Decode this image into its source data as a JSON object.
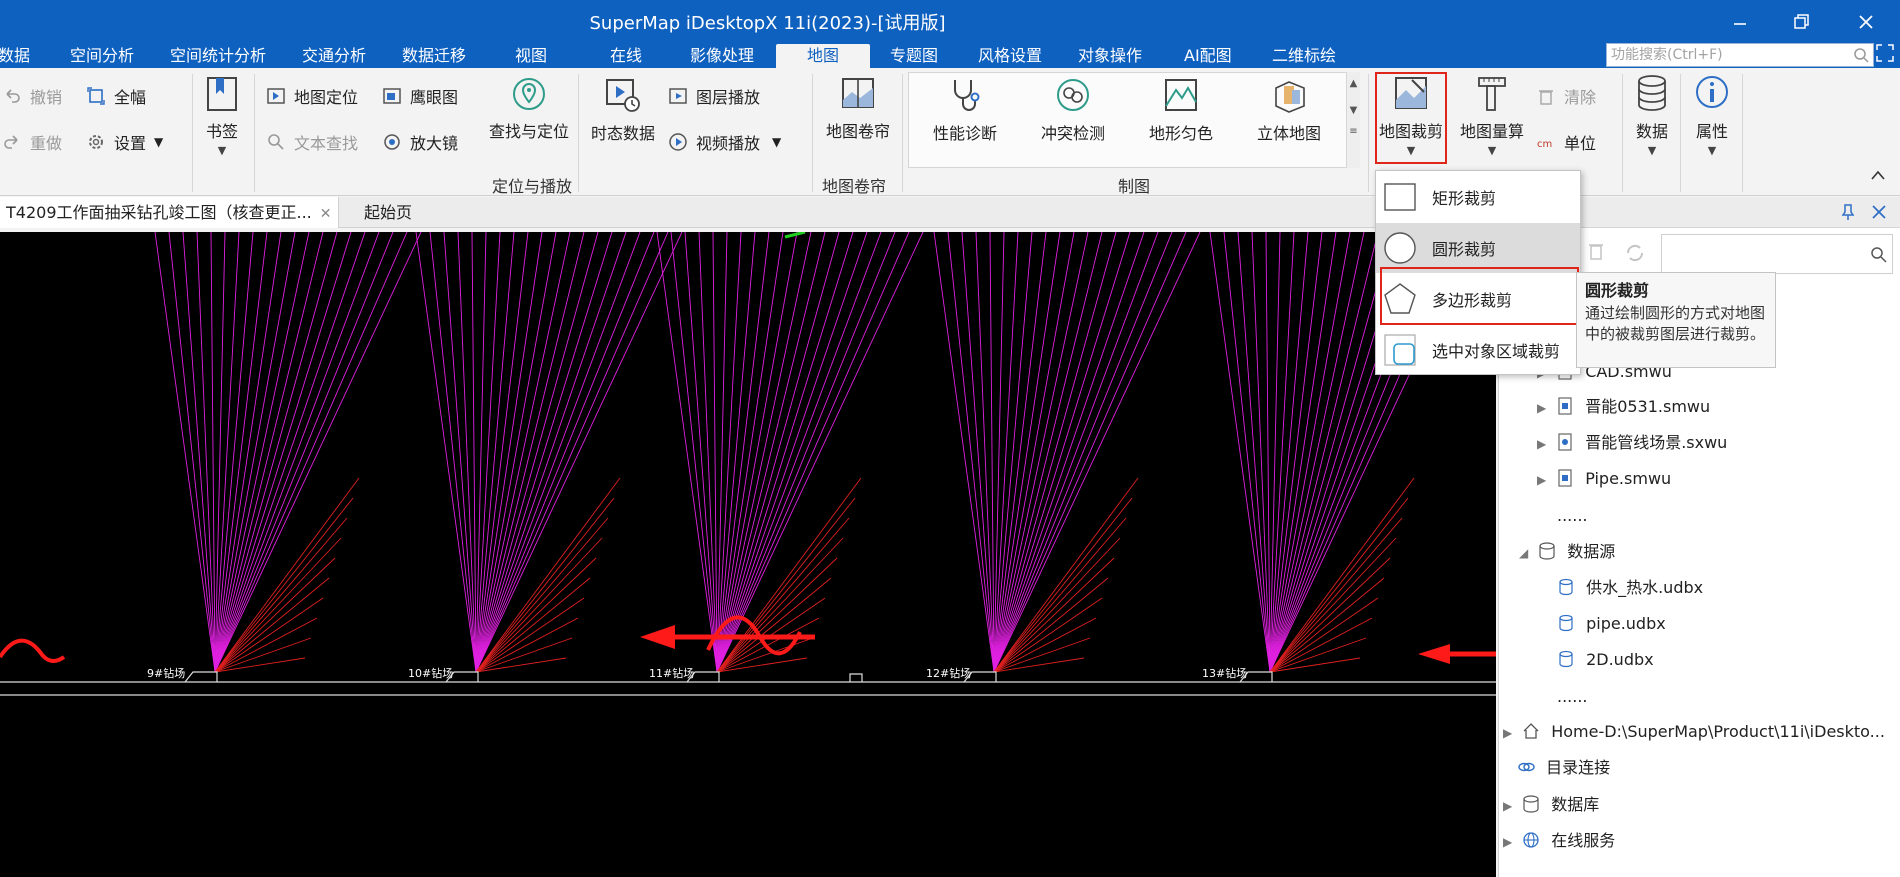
{
  "window": {
    "title": "SuperMap iDesktopX 11i(2023)-[试用版]",
    "accent": "#0f61c0"
  },
  "menu_tabs": [
    "数据",
    "空间分析",
    "空间统计分析",
    "交通分析",
    "数据迁移",
    "视图",
    "在线",
    "影像处理",
    "地图",
    "专题图",
    "风格设置",
    "对象操作",
    "AI配图",
    "二维标绘"
  ],
  "search": {
    "placeholder": "功能搜索(Ctrl+F)"
  },
  "ribbon": {
    "undo": "撤销",
    "redo": "重做",
    "full_extent": "全幅",
    "settings": "设置",
    "bookmark": "书签",
    "map_locate": "地图定位",
    "text_find": "文本查找",
    "eagle_eye": "鹰眼图",
    "magnifier": "放大镜",
    "find_locate": "查找与定位",
    "temporal_data": "时态数据",
    "layer_play": "图层播放",
    "video_play": "视频播放",
    "map_scroll": "地图卷帘",
    "group_locate": "定位与播放",
    "group_scroll": "地图卷帘",
    "perf_diag": "性能诊断",
    "conflict_detect": "冲突检测",
    "terrain_color": "地形匀色",
    "stereo_map": "立体地图",
    "group_mapping": "制图",
    "map_clip": "地图裁剪",
    "map_measure": "地图量算",
    "clear": "清除",
    "unit": "单位",
    "data": "数据",
    "properties": "属性"
  },
  "doc_tabs": [
    {
      "label": "T4209工作面抽采钻孔竣工图（核查更正..."
    },
    {
      "label": "起始页"
    }
  ],
  "map": {
    "labels": [
      "9#钻场",
      "10#钻场",
      "11#钻场",
      "12#钻场",
      "13#钻场"
    ]
  },
  "clip_menu": {
    "items": [
      "矩形裁剪",
      "圆形裁剪",
      "多边形裁剪",
      "选中对象区域裁剪"
    ]
  },
  "tooltip": {
    "title": "圆形裁剪",
    "text": "通过绘制圆形的方式对地图中的被裁剪图层进行裁剪。"
  },
  "tree": {
    "items": [
      "CAD.smwu",
      "晋能0531.smwu",
      "晋能管线场景.sxwu",
      "Pipe.smwu",
      "......",
      "数据源",
      "供水_热水.udbx",
      "pipe.udbx",
      "2D.udbx",
      "......",
      "Home-D:\\SuperMap\\Product\\11i\\iDeskto...",
      "目录连接",
      "数据库",
      "在线服务"
    ]
  }
}
